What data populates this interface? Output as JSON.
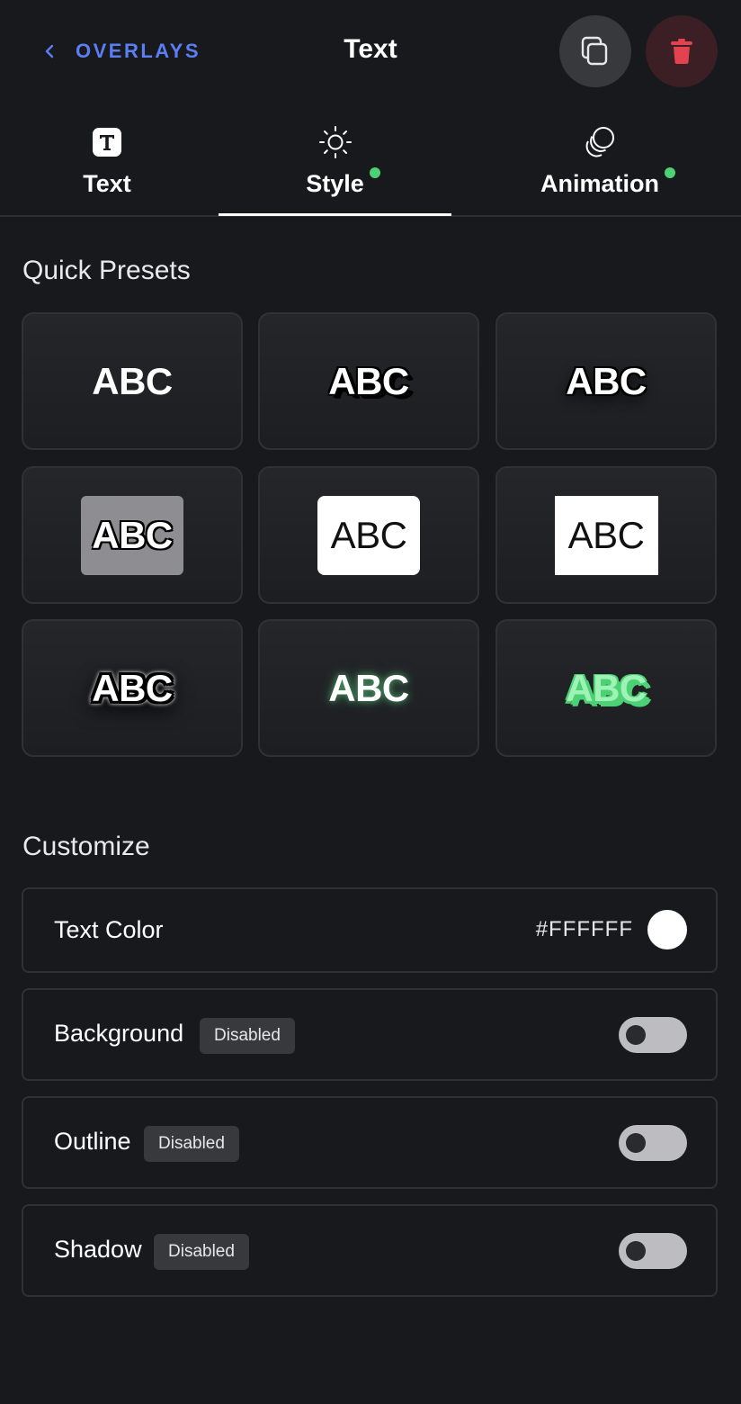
{
  "header": {
    "back_label": "OVERLAYS",
    "title": "Text"
  },
  "tabs": [
    {
      "label": "Text",
      "icon": "text-t-icon",
      "active": false,
      "dot": false
    },
    {
      "label": "Style",
      "icon": "sun-icon",
      "active": true,
      "dot": true
    },
    {
      "label": "Animation",
      "icon": "layers-circles-icon",
      "active": false,
      "dot": true
    }
  ],
  "presets": {
    "title": "Quick Presets",
    "items": [
      {
        "label": "ABC",
        "style": "plain"
      },
      {
        "label": "ABC",
        "style": "hard-shadow"
      },
      {
        "label": "ABC",
        "style": "outline-soft-shadow"
      },
      {
        "label": "ABC",
        "style": "gray-box-outline"
      },
      {
        "label": "ABC",
        "style": "white-rounded-box"
      },
      {
        "label": "ABC",
        "style": "white-square-box"
      },
      {
        "label": "ABC",
        "style": "thick-outline"
      },
      {
        "label": "ABC",
        "style": "green-glow"
      },
      {
        "label": "ABC",
        "style": "green-hard-shadow"
      }
    ]
  },
  "customize": {
    "title": "Customize",
    "text_color": {
      "label": "Text Color",
      "value": "#FFFFFF"
    },
    "background": {
      "label": "Background",
      "badge": "Disabled",
      "enabled": false
    },
    "outline": {
      "label": "Outline",
      "badge": "Disabled",
      "enabled": false
    },
    "shadow": {
      "label": "Shadow",
      "badge": "Disabled",
      "enabled": false
    }
  },
  "colors": {
    "accent_blue": "#5b7ff3",
    "status_green": "#4cd275",
    "danger_red": "#e2434f",
    "background": "#18191d"
  }
}
